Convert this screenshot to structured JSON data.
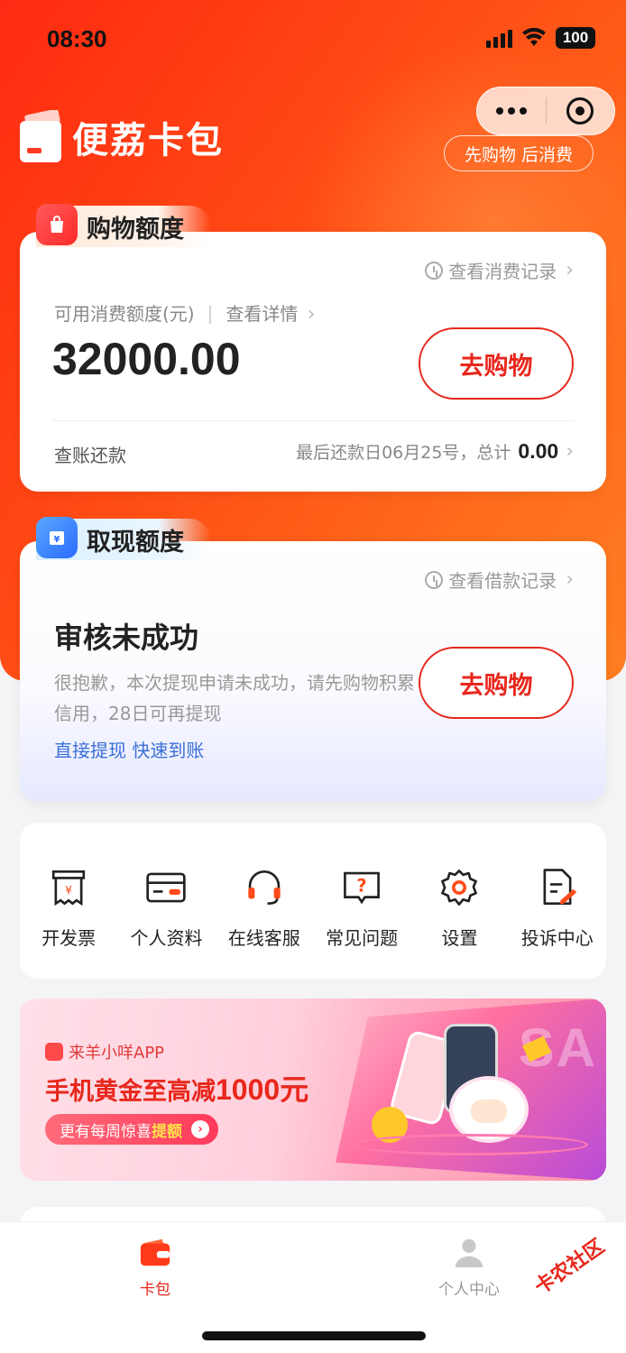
{
  "status_bar": {
    "time": "08:30",
    "battery": "100"
  },
  "header": {
    "app_name": "便荔卡包",
    "slogan": "先购物 后消费"
  },
  "shopping_card": {
    "tab_title": "购物额度",
    "record_link": "查看消费记录",
    "available_label": "可用消费额度(元)",
    "detail_link": "查看详情",
    "amount": "32000.00",
    "go_button": "去购物",
    "bill_label": "查账还款",
    "bill_info": "最后还款日06月25号，总计",
    "bill_total": "0.00"
  },
  "cash_card": {
    "tab_title": "取现额度",
    "record_link": "查看借款记录",
    "status_title": "审核未成功",
    "description": "很抱歉，本次提现申请未成功，请先购物积累信用，28日可再提现",
    "direct_link": "直接提现 快速到账",
    "go_button": "去购物"
  },
  "menu": {
    "items": [
      {
        "label": "开发票",
        "icon": "invoice-icon"
      },
      {
        "label": "个人资料",
        "icon": "id-card-icon"
      },
      {
        "label": "在线客服",
        "icon": "headset-icon"
      },
      {
        "label": "常见问题",
        "icon": "question-icon"
      },
      {
        "label": "设置",
        "icon": "gear-icon"
      },
      {
        "label": "投诉中心",
        "icon": "complaint-icon"
      }
    ]
  },
  "banner": {
    "app_name": "来羊小咩APP",
    "title_prefix": "手机黄金至高减",
    "title_amount": "1000元",
    "pill_text": "更有每周惊喜",
    "pill_highlight": "提额"
  },
  "tabbar": {
    "items": [
      {
        "label": "卡包",
        "active": true
      },
      {
        "label": "个人中心",
        "active": false
      }
    ]
  },
  "watermark": "卡农社区",
  "colors": {
    "brand_red": "#e8271c",
    "hero_orange": "#ff4a14",
    "link_blue": "#3a6fd8"
  }
}
